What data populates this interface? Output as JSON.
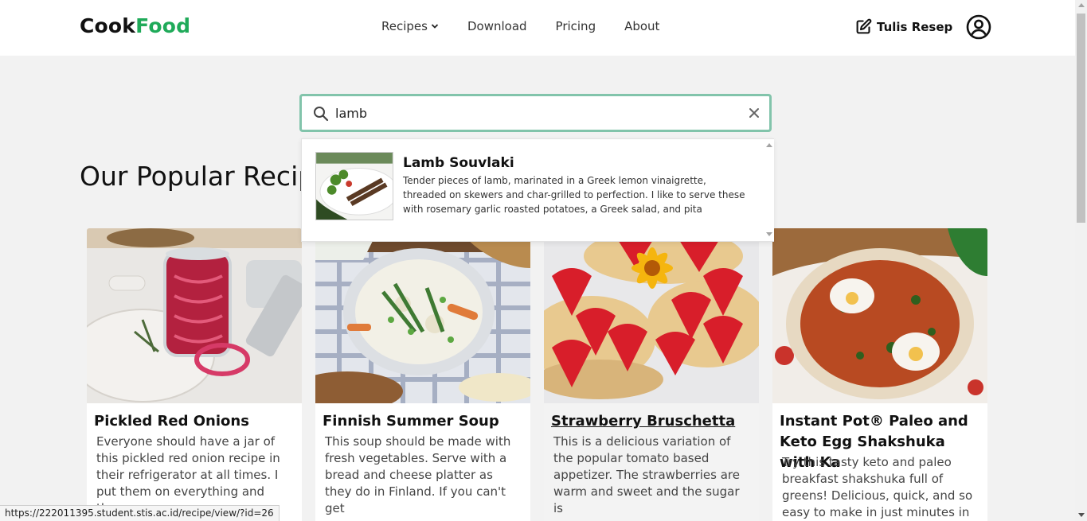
{
  "brand": {
    "part1": "Cook",
    "part2": "Food",
    "color": "#1faa59"
  },
  "nav": {
    "items": [
      {
        "label": "Recipes",
        "has_dropdown": true
      },
      {
        "label": "Download"
      },
      {
        "label": "Pricing"
      },
      {
        "label": "About"
      }
    ],
    "write_label": "Tulis Resep"
  },
  "search": {
    "value": "lamb",
    "results": [
      {
        "title": "Lamb Souvlaki",
        "description": "Tender pieces of lamb, marinated in a Greek lemon vinaigrette, threaded on skewers and char-grilled to perfection. I like to serve these with rosemary garlic roasted potatoes, a Greek salad, and pita"
      }
    ]
  },
  "section": {
    "title": "Our Popular Recipes"
  },
  "cards": [
    {
      "title": "Pickled Red Onions",
      "description": "Everyone should have a jar of this pickled red onion recipe in their refrigerator at all times. I put them on everything and they"
    },
    {
      "title": "Finnish Summer Soup",
      "description": "This soup should be made with fresh vegetables. Serve with a bread and cheese platter as they do in Finland. If you can't get"
    },
    {
      "title": "Strawberry Bruschetta",
      "description": "This is a delicious variation of the popular tomato based appetizer. The strawberries are warm and sweet and the sugar is"
    },
    {
      "title": "Instant Pot® Paleo and Keto Egg Shakshuka with Ka",
      "description": "Try this tasty keto and paleo breakfast shakshuka full of greens! Delicious, quick, and so easy to make in just minutes in"
    }
  ],
  "status_url": "https://222011395.student.stis.ac.id/recipe/view/?id=26"
}
